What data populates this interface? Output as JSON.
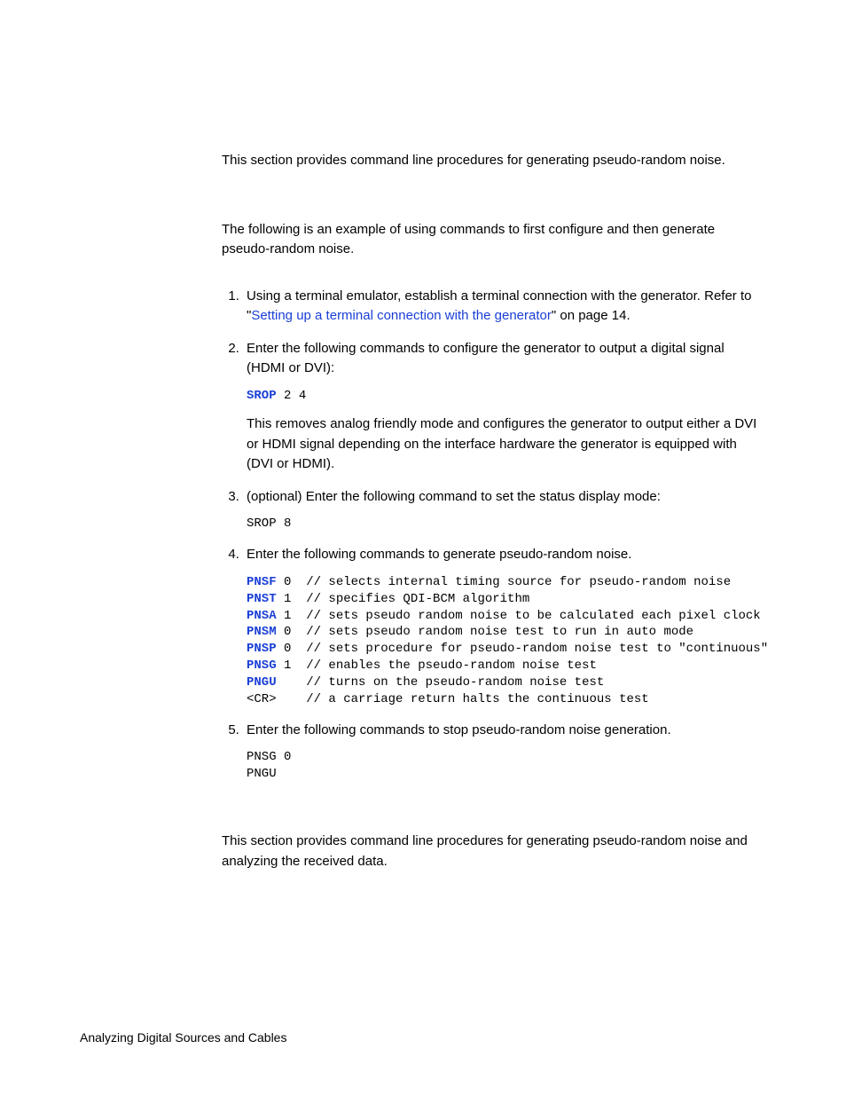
{
  "intro": "This section provides command line procedures for generating pseudo-random noise.",
  "example_intro": "The following is an example of using commands to first configure and then generate pseudo-random noise.",
  "steps": {
    "s1_a": "Using a terminal emulator, establish a terminal connection with the generator. Refer to \"",
    "s1_link": "Setting up a terminal connection with the generator",
    "s1_b": "\" on page 14.",
    "s2_a": "Enter the following commands to configure the generator to output a digital signal (HDMI or DVI):",
    "s2_code_kw": "SROP",
    "s2_code_args": " 2 4",
    "s2_b": "This removes analog friendly mode and configures the generator to output either a DVI or HDMI signal depending on the interface hardware the generator is equipped with (DVI or HDMI).",
    "s3": "(optional) Enter the following command to set the status display mode:",
    "s3_code": "SROP 8",
    "s4": "Enter the following commands to generate pseudo-random noise.",
    "s4_lines": [
      {
        "kw": "PNSF",
        "rest": " 0  // selects internal timing source for pseudo-random noise"
      },
      {
        "kw": "PNST",
        "rest": " 1  // specifies QDI-BCM algorithm"
      },
      {
        "kw": "PNSA",
        "rest": " 1  // sets pseudo random noise to be calculated each pixel clock"
      },
      {
        "kw": "PNSM",
        "rest": " 0  // sets pseudo random noise test to run in auto mode"
      },
      {
        "kw": "PNSP",
        "rest": " 0  // sets procedure for pseudo-random noise test to \"continuous\""
      },
      {
        "kw": "PNSG",
        "rest": " 1  // enables the pseudo-random noise test"
      },
      {
        "kw": "PNGU",
        "rest": "    // turns on the pseudo-random noise test"
      },
      {
        "kw": "",
        "rest": "<CR>    // a carriage return halts the continuous test"
      }
    ],
    "s5": "Enter the following commands to stop pseudo-random noise generation.",
    "s5_code": "PNSG 0\nPNGU"
  },
  "outro": "This section provides command line procedures for generating pseudo-random noise and analyzing the received data.",
  "footer": "Analyzing Digital Sources and Cables"
}
